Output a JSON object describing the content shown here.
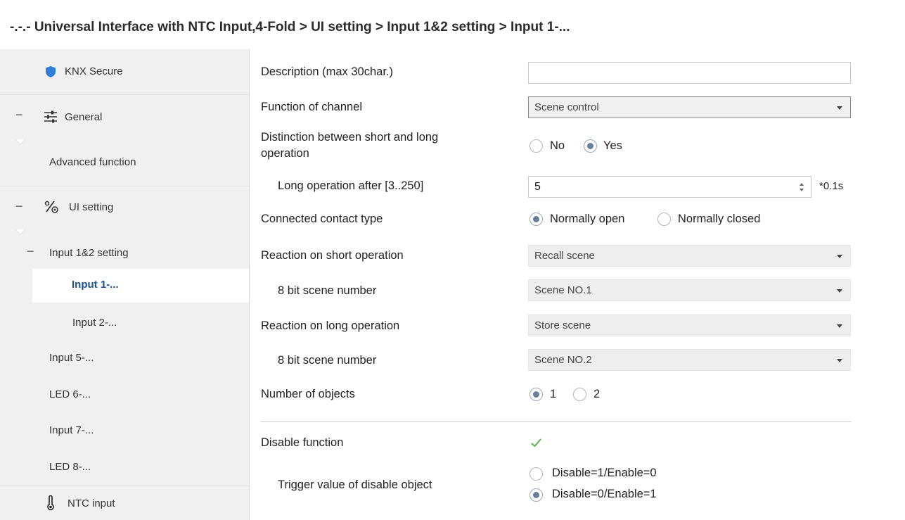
{
  "header": {
    "title": "-.-.- Universal Interface with NTC Input,4-Fold > UI setting > Input 1&2 setting > Input 1-..."
  },
  "sidebar": {
    "knx_secure": "KNX Secure",
    "general": "General",
    "advanced_function": "Advanced function",
    "ui_setting": "UI setting",
    "input_12_setting": "Input 1&2 setting",
    "input_1": "Input 1-...",
    "input_2": "Input 2-...",
    "input_5": "Input 5-...",
    "led_6": "LED 6-...",
    "input_7": "Input 7-...",
    "led_8": "LED 8-...",
    "ntc_input": "NTC input",
    "dash": "−"
  },
  "form": {
    "description": {
      "label": "Description (max 30char.)",
      "value": ""
    },
    "function_of_channel": {
      "label": "Function of channel",
      "value": "Scene control"
    },
    "distinction": {
      "label_line1": "Distinction between short and long",
      "label_line2": "operation",
      "options": [
        "No",
        "Yes"
      ],
      "selected": "Yes"
    },
    "long_operation": {
      "label": "Long operation after [3..250]",
      "value": "5",
      "unit": "*0.1s"
    },
    "contact_type": {
      "label": "Connected contact type",
      "options": [
        "Normally open",
        "Normally closed"
      ],
      "selected": "Normally open"
    },
    "reaction_short": {
      "label": "Reaction on short operation",
      "value": "Recall scene"
    },
    "scene_number_short": {
      "label": "8 bit scene number",
      "value": "Scene NO.1"
    },
    "reaction_long": {
      "label": "Reaction on long operation",
      "value": "Store scene"
    },
    "scene_number_long": {
      "label": "8 bit scene number",
      "value": "Scene NO.2"
    },
    "number_of_objects": {
      "label": "Number of objects",
      "options": [
        "1",
        "2"
      ],
      "selected": "1"
    },
    "disable_function": {
      "label": "Disable function",
      "checked": true
    },
    "trigger_value": {
      "label": "Trigger value of disable object",
      "options": [
        "Disable=1/Enable=0",
        "Disable=0/Enable=1"
      ],
      "selected": "Disable=0/Enable=1"
    }
  },
  "colors": {
    "selected_nav_text": "#1a4f96",
    "sidebar_bg": "#f0f0f0",
    "radio_dot": "#6a7f99",
    "checkmark": "#5cae4f",
    "shield": "#2f7fd6"
  },
  "icons": {
    "knx_secure": "shield-icon",
    "general": "sliders-icon",
    "ui_setting": "percent-gear-icon",
    "ntc_input": "thermometer-icon"
  }
}
